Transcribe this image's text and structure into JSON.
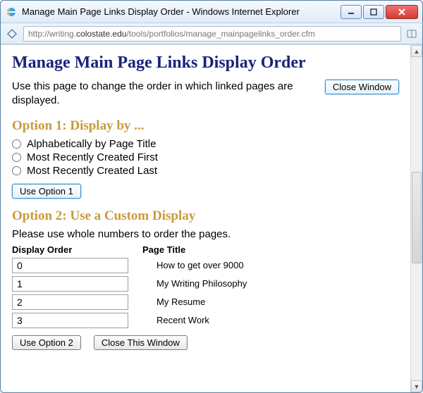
{
  "window": {
    "title": "Manage Main Page Links Display Order - Windows Internet Explorer",
    "url_prefix": "http://writing.",
    "url_host": "colostate.edu",
    "url_path": "/tools/portfolios/manage_mainpagelinks_order.cfm"
  },
  "page": {
    "heading": "Manage Main Page Links Display Order",
    "intro": "Use this page to change the order in which linked pages are displayed.",
    "close_window_btn": "Close Window"
  },
  "option1": {
    "heading": "Option 1: Display by ...",
    "choices": [
      "Alphabetically by Page Title",
      "Most Recently Created First",
      "Most Recently Created Last"
    ],
    "submit": "Use Option 1"
  },
  "option2": {
    "heading": "Option 2: Use a Custom Display",
    "instructions": "Please use whole numbers to order the pages.",
    "col_order": "Display Order",
    "col_title": "Page Title",
    "rows": [
      {
        "order": "0",
        "title": "How to get over 9000"
      },
      {
        "order": "1",
        "title": "My Writing Philosophy"
      },
      {
        "order": "2",
        "title": "My Resume"
      },
      {
        "order": "3",
        "title": "Recent Work"
      }
    ],
    "submit": "Use Option 2",
    "close": "Close This Window"
  }
}
